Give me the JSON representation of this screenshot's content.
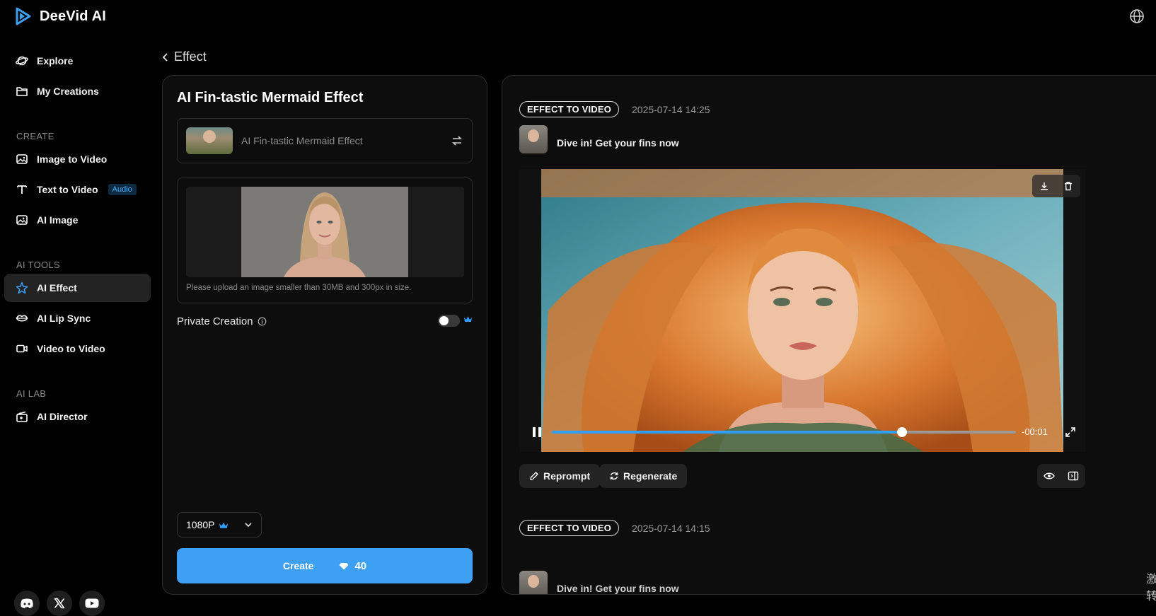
{
  "app": {
    "name": "DeeVid AI"
  },
  "sidebar": {
    "top_items": [
      {
        "label": "Explore",
        "icon": "planet-icon"
      },
      {
        "label": "My Creations",
        "icon": "folder-icon"
      }
    ],
    "sections": [
      {
        "label": "CREATE",
        "items": [
          {
            "label": "Image to Video",
            "icon": "image-icon"
          },
          {
            "label": "Text to Video",
            "icon": "text-icon",
            "badge": "Audio"
          },
          {
            "label": "AI Image",
            "icon": "ai-image-icon"
          }
        ]
      },
      {
        "label": "AI TOOLS",
        "items": [
          {
            "label": "AI Effect",
            "icon": "sparkle-icon",
            "active": true
          },
          {
            "label": "AI Lip Sync",
            "icon": "lips-icon"
          },
          {
            "label": "Video to Video",
            "icon": "video-icon"
          }
        ]
      },
      {
        "label": "AI LAB",
        "items": [
          {
            "label": "AI Director",
            "icon": "director-icon"
          }
        ]
      }
    ],
    "socials": [
      "discord-icon",
      "x-icon",
      "youtube-icon"
    ]
  },
  "header": {
    "back_label": "Effect"
  },
  "form": {
    "title": "AI Fin-tastic Mermaid Effect",
    "effect_name": "AI Fin-tastic Mermaid Effect",
    "upload_hint": "Please upload an image smaller than 30MB and 300px in size.",
    "private_label": "Private Creation",
    "private_enabled": false,
    "resolution": "1080P",
    "create_label": "Create",
    "create_cost": "40"
  },
  "results": [
    {
      "tag": "EFFECT TO VIDEO",
      "timestamp": "2025-07-14 14:25",
      "prompt": "Dive in! Get your fins now",
      "player": {
        "time_remaining": "-00:01",
        "progress_fraction": 0.754
      },
      "actions": {
        "reprompt": "Reprompt",
        "regenerate": "Regenerate"
      }
    },
    {
      "tag": "EFFECT TO VIDEO",
      "timestamp": "2025-07-14 14:15",
      "prompt": "Dive in! Get your fins now"
    }
  ],
  "side_chars": "激 转",
  "colors": {
    "accent": "#3ea0f2",
    "progress": "#2f9fff",
    "badge": "#3fb0ff"
  }
}
